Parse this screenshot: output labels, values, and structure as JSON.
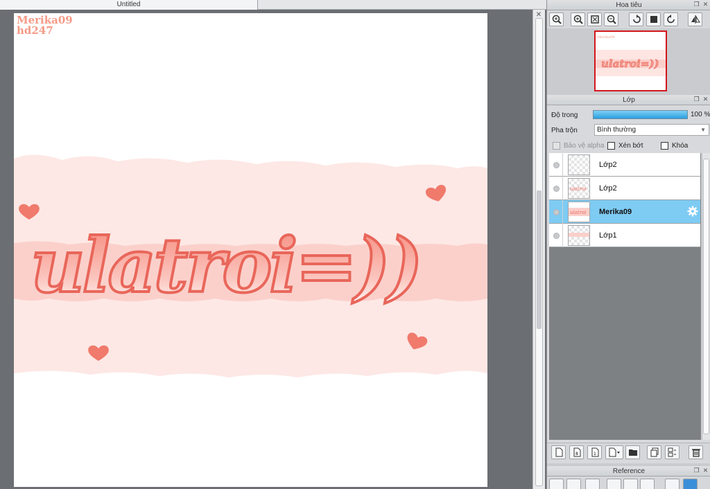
{
  "document": {
    "tab_title": "Untitled"
  },
  "canvas": {
    "watermark_line1": "Merika09",
    "watermark_line2": "hd247",
    "colors": {
      "band_light": "#fde5e2",
      "band_mid": "#fbcfca",
      "lettering": "#f27b6e",
      "heart": "#f07a6c"
    }
  },
  "navigator": {
    "title": "Hoa tiêu",
    "tools": [
      "zoom-in-icon",
      "zoom-in-icon",
      "fit-icon",
      "zoom-out-icon",
      "rotate-left-icon",
      "reset-icon",
      "rotate-right-icon",
      "flip-icon"
    ]
  },
  "layers": {
    "title": "Lớp",
    "opacity_label": "Độ trong",
    "opacity_value": "100 %",
    "opacity": 1.0,
    "blend_label": "Pha trộn",
    "blend_value": "Bình thường",
    "protect_alpha": "Bảo vệ alpha",
    "clipping": "Xén bớt",
    "lock": "Khóa",
    "items": [
      {
        "name": "Lớp2",
        "selected": false
      },
      {
        "name": "Lớp2",
        "selected": false
      },
      {
        "name": "Merika09",
        "selected": true
      },
      {
        "name": "Lớp1",
        "selected": false
      }
    ],
    "toolbar": [
      "new-layer-icon",
      "new-layer-8bit-icon",
      "new-layer-1bit-icon",
      "add-layer-menu-icon",
      "new-folder-icon",
      "duplicate-layer-icon",
      "merge-down-icon",
      "delete-layer-icon"
    ]
  },
  "reference": {
    "title": "Reference"
  }
}
